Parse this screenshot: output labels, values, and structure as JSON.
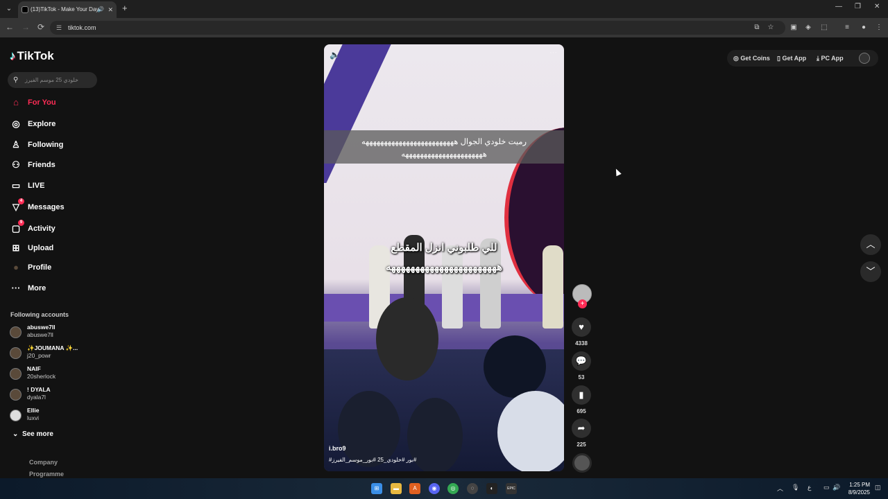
{
  "browser": {
    "tab_title": "(13)TikTok - Make Your Day",
    "speaker_glyph": "🔊",
    "close_glyph": "✕",
    "newtab_glyph": "+",
    "url": "tiktok.com",
    "back_glyph": "←",
    "forward_glyph": "→",
    "reload_glyph": "⟳",
    "minimize_glyph": "—",
    "restore_glyph": "❐",
    "window_close_glyph": "✕"
  },
  "sidebar": {
    "logo_text": "TikTok",
    "search_placeholder": "خلودي 25 موسم الفيرز",
    "menu": [
      {
        "label": "For You",
        "icon": "home-icon",
        "active": true
      },
      {
        "label": "Explore",
        "icon": "compass-icon"
      },
      {
        "label": "Following",
        "icon": "following-icon"
      },
      {
        "label": "Friends",
        "icon": "friends-icon"
      },
      {
        "label": "LIVE",
        "icon": "live-icon"
      },
      {
        "label": "Messages",
        "icon": "messages-icon",
        "badge": "4"
      },
      {
        "label": "Activity",
        "icon": "activity-icon",
        "badge": "9"
      },
      {
        "label": "Upload",
        "icon": "upload-icon"
      },
      {
        "label": "Profile",
        "icon": "profile-icon"
      },
      {
        "label": "More",
        "icon": "more-icon"
      }
    ],
    "following_title": "Following accounts",
    "accounts": [
      {
        "name": "abuswe7ll",
        "handle": "abuswe7ll"
      },
      {
        "name": "✨JOUMANA ✨...",
        "handle": "j20_powr"
      },
      {
        "name": "NAIF",
        "handle": "20sherlock"
      },
      {
        "name": "! DYALA",
        "handle": "dyala7l"
      },
      {
        "name": "Ellie",
        "handle": "luxvi"
      }
    ],
    "see_more": "See more",
    "footer_links": [
      "Company",
      "Programme"
    ]
  },
  "top_actions": {
    "get_coins": "Get Coins",
    "get_app": "Get App",
    "pc_app": "PC App"
  },
  "video": {
    "caption_top": "رميت خلودي الجوال هههههههههههههههههههههههههه ههههههههههههههههههههههه",
    "caption_main": "للي طلبوني انزل المقطع هههههههههههههههههههههههه",
    "author": "i.bro9",
    "hashtags": "#بور #خلودي_25 #بور_موسم_الفيرز#",
    "likes": "4338",
    "comments": "53",
    "saves": "695",
    "shares": "225"
  },
  "taskbar": {
    "time": "1:25 PM",
    "date": "8/9/2025",
    "lang": "ع"
  }
}
